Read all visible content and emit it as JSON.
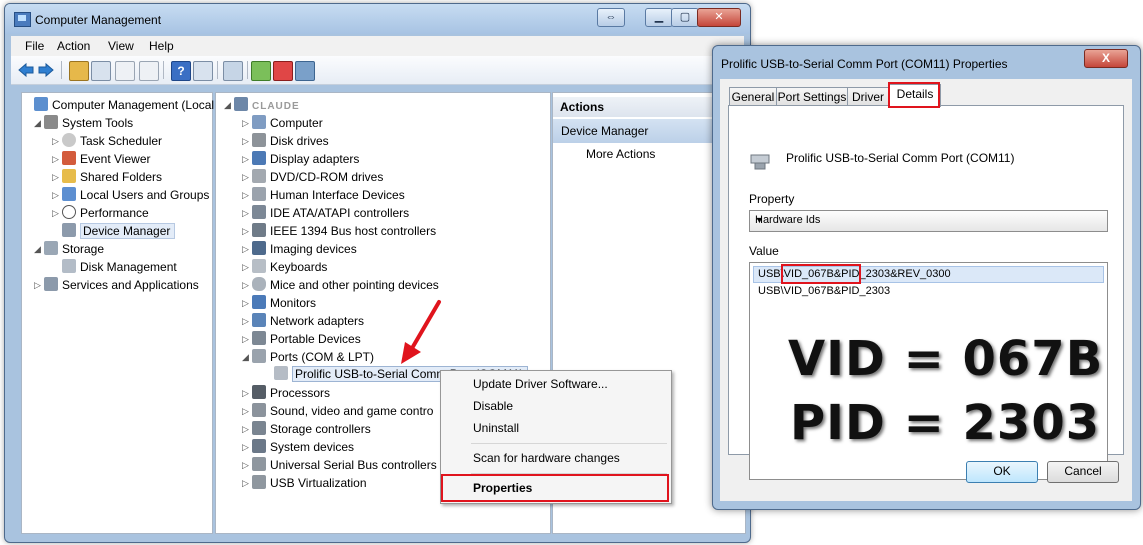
{
  "main_window": {
    "title": "Computer Management",
    "menu": [
      "File",
      "Action",
      "View",
      "Help"
    ]
  },
  "tree": {
    "items": [
      {
        "label": "Computer Management (Local",
        "level": 0,
        "expanded": true
      },
      {
        "label": "System Tools",
        "level": 1,
        "expanded": true
      },
      {
        "label": "Task Scheduler",
        "level": 2
      },
      {
        "label": "Event Viewer",
        "level": 2
      },
      {
        "label": "Shared Folders",
        "level": 2
      },
      {
        "label": "Local Users and Groups",
        "level": 2
      },
      {
        "label": "Performance",
        "level": 2
      },
      {
        "label": "Device Manager",
        "level": 2,
        "selected": true
      },
      {
        "label": "Storage",
        "level": 1,
        "expanded": true
      },
      {
        "label": "Disk Management",
        "level": 2
      },
      {
        "label": "Services and Applications",
        "level": 1
      }
    ]
  },
  "devices": {
    "root_label": "CLAUDE",
    "categories": [
      "Computer",
      "Disk drives",
      "Display adapters",
      "DVD/CD-ROM drives",
      "Human Interface Devices",
      "IDE ATA/ATAPI controllers",
      "IEEE 1394 Bus host controllers",
      "Imaging devices",
      "Keyboards",
      "Mice and other pointing devices",
      "Monitors",
      "Network adapters",
      "Portable Devices",
      "Ports (COM & LPT)",
      "Prolific USB-to-Serial Comm Port (COM11)",
      "Processors",
      "Sound, video and game contro",
      "Storage controllers",
      "System devices",
      "Universal Serial Bus controllers",
      "USB Virtualization"
    ]
  },
  "actions": {
    "header": "Actions",
    "section": "Device Manager",
    "more": "More Actions"
  },
  "context_menu": {
    "items": [
      "Update Driver Software...",
      "Disable",
      "Uninstall",
      "Scan for hardware changes",
      "Properties"
    ]
  },
  "dialog": {
    "title": "Prolific USB-to-Serial Comm Port (COM11) Properties",
    "close": "X",
    "tabs": [
      "General",
      "Port Settings",
      "Driver",
      "Details"
    ],
    "active_tab": "Details",
    "device_name": "Prolific USB-to-Serial Comm Port (COM11)",
    "property_label": "Property",
    "property_value": "Hardware Ids",
    "value_label": "Value",
    "values": [
      "USB\\VID_067B&PID_2303&REV_0300",
      "USB\\VID_067B&PID_2303"
    ],
    "overlay_line1": "VID = 067B",
    "overlay_line2": "PID = 2303",
    "ok": "OK",
    "cancel": "Cancel"
  },
  "colors": {
    "highlight_red": "#e0141d",
    "window_frame": "#a9c3df"
  }
}
